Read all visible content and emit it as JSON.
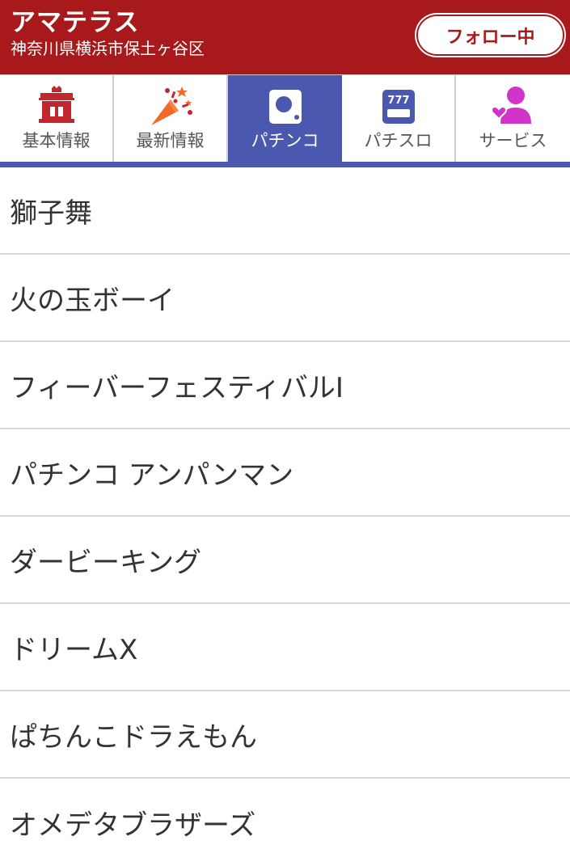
{
  "header": {
    "store_name": "アマテラス",
    "address": "神奈川県横浜市保土ヶ谷区",
    "follow_label": "フォロー中"
  },
  "tabs": [
    {
      "label": "基本情報",
      "icon": "building-icon",
      "active": false
    },
    {
      "label": "最新情報",
      "icon": "party-popper-icon",
      "active": false
    },
    {
      "label": "パチンコ",
      "icon": "pachinko-machine-icon",
      "active": true
    },
    {
      "label": "パチスロ",
      "icon": "slot-machine-777-icon",
      "active": false
    },
    {
      "label": "サービス",
      "icon": "person-heart-icon",
      "active": false
    }
  ],
  "machines": [
    "獅子舞",
    "火の玉ボーイ",
    "フィーバーフェスティバルI",
    "パチンコ アンパンマン",
    "ダービーキング",
    "ドリームX",
    "ぱちんこドラえもん",
    "オメデタブラザーズ"
  ],
  "colors": {
    "header_bg": "#a8191b",
    "tab_active_bg": "#4a58b0",
    "icon_red": "#c1272d",
    "icon_blue": "#4a58b0",
    "icon_magenta": "#d233c8",
    "icon_orange": "#ef6a2a"
  }
}
